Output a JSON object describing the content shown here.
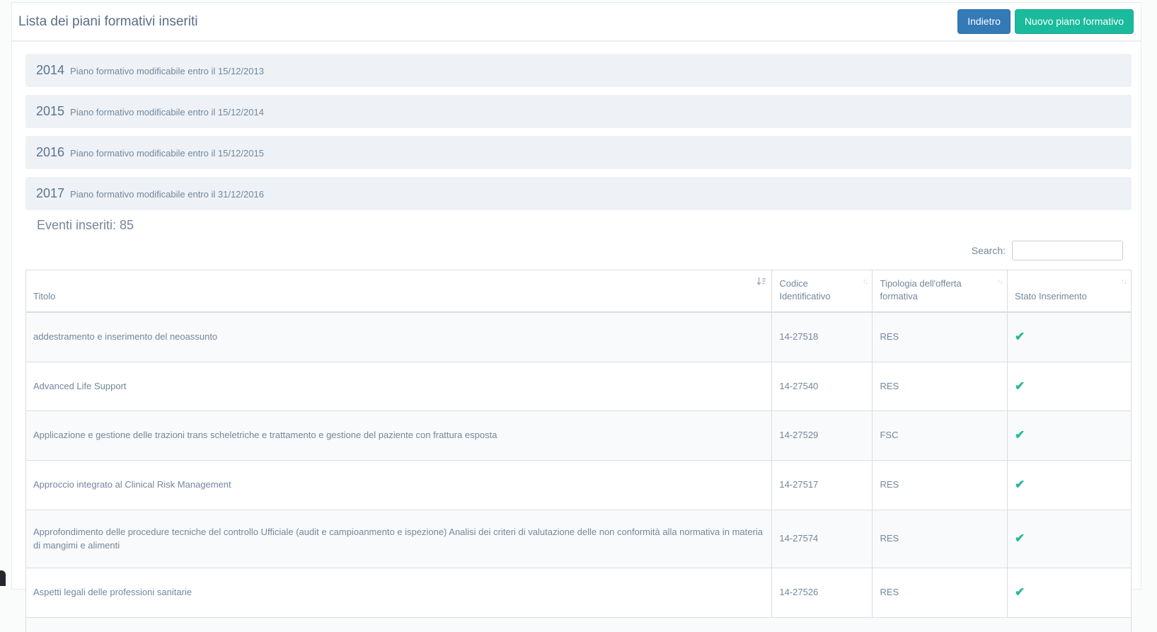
{
  "header": {
    "title": "Lista dei piani formativi inseriti",
    "back_button": "Indietro",
    "new_button": "Nuovo piano formativo"
  },
  "panels": [
    {
      "year": "2014",
      "note": "Piano formativo modificabile entro il 15/12/2013"
    },
    {
      "year": "2015",
      "note": "Piano formativo modificabile entro il 15/12/2014"
    },
    {
      "year": "2016",
      "note": "Piano formativo modificabile entro il 15/12/2015"
    },
    {
      "year": "2017",
      "note": "Piano formativo modificabile entro il 31/12/2016"
    }
  ],
  "events": {
    "title": "Eventi inseriti: 85",
    "count": 85
  },
  "search": {
    "label": "Search:",
    "value": ""
  },
  "table": {
    "columns": [
      "Titolo",
      "Codice Identificativo",
      "Tipologia dell'offerta formativa",
      "Stato Inserimento"
    ],
    "sort": {
      "column": "Titolo",
      "direction": "asc"
    },
    "rows": [
      {
        "titolo": "addestramento e inserimento del neoassunto",
        "codice": "14-27518",
        "tipologia": "RES",
        "stato_inserito": true
      },
      {
        "titolo": "Advanced Life Support",
        "codice": "14-27540",
        "tipologia": "RES",
        "stato_inserito": true
      },
      {
        "titolo": "Applicazione e gestione delle trazioni trans scheletriche e trattamento e gestione del paziente con frattura esposta",
        "codice": "14-27529",
        "tipologia": "FSC",
        "stato_inserito": true
      },
      {
        "titolo": "Approccio integrato al Clinical Risk Management",
        "codice": "14-27517",
        "tipologia": "RES",
        "stato_inserito": true
      },
      {
        "titolo": "Approfondimento delle procedure tecniche del controllo Ufficiale (audit e campioanmento e ispezione) Analisi dei criteri di valutazione delle non conformità alla normativa in materia di mangimi e alimenti",
        "codice": "14-27574",
        "tipologia": "RES",
        "stato_inserito": true
      },
      {
        "titolo": "Aspetti legali delle professioni sanitarie",
        "codice": "14-27526",
        "tipologia": "RES",
        "stato_inserito": true
      }
    ]
  },
  "icons": {
    "check": "✔",
    "sort_unsorted": "↑↓"
  },
  "colors": {
    "accent_blue": "#337ab7",
    "accent_green": "#1abb9c",
    "check_green": "#26b99a",
    "panel_bg": "#eef2f6",
    "text": "#73879C"
  }
}
